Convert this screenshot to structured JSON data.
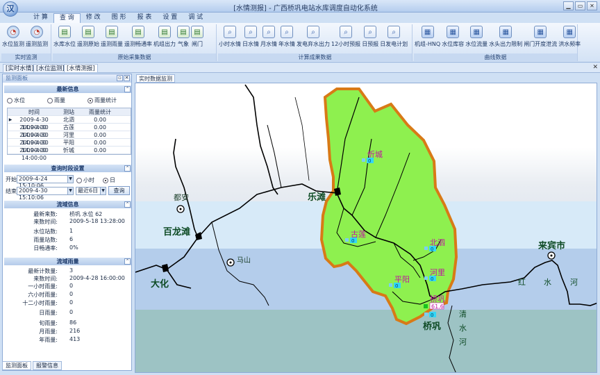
{
  "window": {
    "title": "[水情测报] - 广西桥巩电站水库调度自动化系统",
    "logo": "汉",
    "controls": [
      "▁",
      "▭",
      "✕"
    ]
  },
  "menu_tabs": [
    "计 算",
    "查 询",
    "修 改",
    "图 形",
    "报 表",
    "设 置",
    "调 试"
  ],
  "active_tab": "查 询",
  "ribbon": {
    "groups": [
      {
        "label": "实时监测",
        "buttons": [
          {
            "label": "水位监测",
            "icon": "gauge-icon"
          },
          {
            "label": "遥测监测",
            "icon": "gauge-icon"
          }
        ]
      },
      {
        "label": "原始采集数据",
        "buttons": [
          {
            "label": "水库水位",
            "icon": "sheet-icon"
          },
          {
            "label": "遥测原始",
            "icon": "sheet-icon"
          },
          {
            "label": "遥测雨量",
            "icon": "sheet-icon"
          },
          {
            "label": "遥测畅通率",
            "icon": "sheet-icon"
          },
          {
            "label": "机组出力",
            "icon": "sheet-icon"
          },
          {
            "label": "气象",
            "icon": "sheet-icon"
          },
          {
            "label": "闸门",
            "icon": "sheet-icon"
          }
        ]
      },
      {
        "label": "计算成果数据",
        "buttons": [
          {
            "label": "小时水情",
            "icon": "search-icon"
          },
          {
            "label": "日水情",
            "icon": "search-icon"
          },
          {
            "label": "月水情",
            "icon": "search-icon"
          },
          {
            "label": "年水情",
            "icon": "search-icon"
          },
          {
            "label": "发电弃水出力",
            "icon": "search-icon"
          },
          {
            "label": "12小时预报",
            "icon": "search-icon"
          },
          {
            "label": "日预报",
            "icon": "search-icon"
          },
          {
            "label": "日发电计划",
            "icon": "search-icon"
          }
        ]
      },
      {
        "label": "曲线数据",
        "buttons": [
          {
            "label": "机组-HNQ",
            "icon": "phone-icon"
          },
          {
            "label": "水位库容",
            "icon": "phone-icon"
          },
          {
            "label": "水位流量",
            "icon": "phone-icon"
          },
          {
            "label": "水头出力限制",
            "icon": "phone-icon"
          },
          {
            "label": "闸门开度泄流",
            "icon": "phone-icon"
          },
          {
            "label": "洪水频率",
            "icon": "phone-icon"
          }
        ]
      }
    ]
  },
  "doc_tabs": [
    "[实时水情]",
    "[水位监测]",
    "[水情测报]"
  ],
  "side_panel": {
    "title": "监测面板",
    "latest": {
      "header": "最新信息",
      "radios": [
        {
          "label": "水位",
          "checked": false
        },
        {
          "label": "雨量",
          "checked": false
        },
        {
          "label": "雨量统计",
          "checked": true
        }
      ],
      "columns": [
        "时间",
        "测站",
        "雨量统计"
      ],
      "rows": [
        [
          "2009-4-30 14:00:00",
          "北泗",
          "0.00"
        ],
        [
          "2009-4-30 14:00:00",
          "古莲",
          "0.00"
        ],
        [
          "2009-4-30 14:00:00",
          "河里",
          "0.00"
        ],
        [
          "2009-4-30 14:00:00",
          "平阳",
          "0.00"
        ],
        [
          "2009-4-30 14:00:00",
          "忻城",
          "0.00"
        ]
      ]
    },
    "query": {
      "header": "查询时段设置",
      "start_label": "开始",
      "start": "2009-4-24 15:10:06",
      "end_label": "结束",
      "end": "2009-4-30 15:10:06",
      "unit_radios": [
        {
          "label": "小时",
          "checked": false
        },
        {
          "label": "日",
          "checked": true
        }
      ],
      "range": "最近6日",
      "button": "查询"
    },
    "basin": {
      "header": "流域信息",
      "items": [
        {
          "k": "最新来数:",
          "v": "桥巩 水位 62"
        },
        {
          "k": "来数时间:",
          "v": "2009-5-18 13:28:00"
        },
        {
          "k": "水位站数:",
          "v": "1"
        },
        {
          "k": "雨量站数:",
          "v": "6"
        },
        {
          "k": "日畅通率:",
          "v": "0%"
        }
      ]
    },
    "rain": {
      "header": "流域雨量",
      "items": [
        {
          "k": "最新计数量:",
          "v": "3"
        },
        {
          "k": "来数时间:",
          "v": "2009-4-28 16:00:00"
        },
        {
          "k": "一小时雨量:",
          "v": "0"
        },
        {
          "k": "六小时雨量:",
          "v": "0"
        },
        {
          "k": "十二小时雨量:",
          "v": "0"
        },
        {
          "k": "日雨量:",
          "v": "0"
        },
        {
          "k": "旬雨量:",
          "v": "86"
        },
        {
          "k": "月雨量:",
          "v": "216"
        },
        {
          "k": "年雨量:",
          "v": "413"
        }
      ]
    },
    "bottom_tabs": [
      "监测面板",
      "报警信息"
    ]
  },
  "map": {
    "tab": "实时数据监测",
    "towns": [
      {
        "name": "都安",
        "type": "town"
      },
      {
        "name": "百龙滩",
        "type": "station"
      },
      {
        "name": "大化",
        "type": "station"
      },
      {
        "name": "马山",
        "type": "town"
      },
      {
        "name": "乐滩",
        "type": "station"
      },
      {
        "name": "来宾市",
        "type": "town"
      },
      {
        "name": "桥巩",
        "type": "station"
      }
    ],
    "stations": [
      {
        "name": "忻城",
        "value": "0"
      },
      {
        "name": "古莲",
        "value": "0"
      },
      {
        "name": "北泗",
        "value": "0"
      },
      {
        "name": "河里",
        "value": "0"
      },
      {
        "name": "平阳",
        "value": "0"
      },
      {
        "name": "桥巩",
        "value": "0",
        "level": "61.6"
      }
    ],
    "river_labels": [
      "红",
      "水",
      "河",
      "清",
      "水",
      "河"
    ],
    "colors": {
      "basin_fill": "#8ef04f",
      "basin_border": "#d87a16",
      "river": "#000000",
      "station_label": "#c0149f",
      "value_bg": "#33d6f5"
    }
  }
}
